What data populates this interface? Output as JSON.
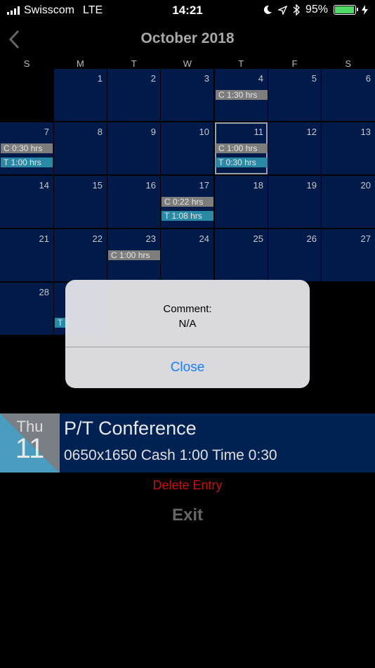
{
  "status_bar": {
    "carrier": "Swisscom",
    "network": "LTE",
    "time": "14:21",
    "battery": "95%",
    "icons": [
      "signal-icon",
      "moon-icon",
      "location-icon",
      "bluetooth-icon",
      "battery-icon",
      "charging-icon"
    ]
  },
  "header": {
    "back_symbol": "‹",
    "month_title": "October 2018"
  },
  "weekdays": [
    "S",
    "M",
    "T",
    "W",
    "T",
    "F",
    "S"
  ],
  "calendar": {
    "days": {
      "d1": "1",
      "d2": "2",
      "d3": "3",
      "d4": "4",
      "d5": "5",
      "d6": "6",
      "d7": "7",
      "d8": "8",
      "d9": "9",
      "d10": "10",
      "d11": "11",
      "d12": "12",
      "d13": "13",
      "d14": "14",
      "d15": "15",
      "d16": "16",
      "d17": "17",
      "d18": "18",
      "d19": "19",
      "d20": "20",
      "d21": "21",
      "d22": "22",
      "d23": "23",
      "d24": "24",
      "d25": "25",
      "d26": "26",
      "d27": "27",
      "d28": "28"
    },
    "entries": {
      "d4_c": "C 1:30 hrs",
      "d7_c": "C 0:30 hrs",
      "d7_t": "T 1:00 hrs",
      "d11_c": "C 1:00 hrs",
      "d11_t": "T 0:30 hrs",
      "d17_c": "C 0:22 hrs",
      "d17_t": "T 1:08 hrs",
      "d23_c": "C 1:00 hrs",
      "d29_t": "T"
    },
    "selected_day": "11"
  },
  "dialog": {
    "label": "Comment:",
    "value": "N/A",
    "close_label": "Close"
  },
  "entry": {
    "day_of_week": "Thu",
    "day_number": "11",
    "title": "P/T Conference",
    "detail": "0650x1650 Cash 1:00 Time 0:30"
  },
  "actions": {
    "delete_label": "Delete Entry",
    "exit_label": "Exit"
  },
  "colors": {
    "cell_bg": "#001a4a",
    "cash_tag": "#7d7d7d",
    "time_tag": "#2a8aa6",
    "delete": "#c41214",
    "link": "#1a7ef5"
  }
}
